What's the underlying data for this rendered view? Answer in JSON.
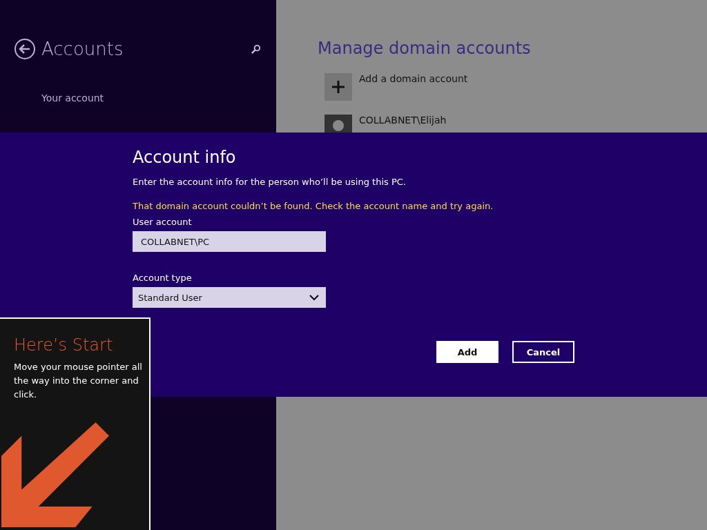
{
  "sidebar": {
    "title": "Accounts",
    "items": [
      {
        "label": "Your account"
      }
    ]
  },
  "main": {
    "title": "Manage domain accounts",
    "items": [
      {
        "kind": "add",
        "label": "Add a domain account"
      },
      {
        "kind": "user",
        "label": "COLLABNET\\Elijah"
      }
    ]
  },
  "dialog": {
    "title": "Account info",
    "intro": "Enter the account info for the person who’ll be using this PC.",
    "error": "That domain account couldn’t be found. Check the account name and try again.",
    "user_label": "User account",
    "user_value": "COLLABNET\\PC",
    "type_label": "Account type",
    "type_value": "Standard User",
    "buttons": [
      {
        "label": "Add",
        "kind": "primary"
      },
      {
        "label": "Cancel",
        "kind": "secondary"
      }
    ]
  },
  "tip": {
    "title": "Here’s Start",
    "text": "Move your mouse pointer all the way into the corner and click."
  }
}
